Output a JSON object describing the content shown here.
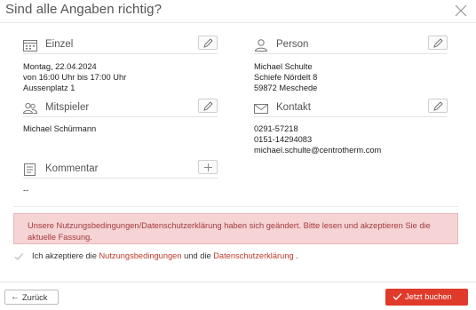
{
  "dialog": {
    "title": "Sind alle Angaben richtig?",
    "close_icon": "close-icon"
  },
  "sections": {
    "einzel": {
      "label": "Einzel",
      "icon": "calendar-icon",
      "lines": [
        "Montag, 22.04.2024",
        "von 16:00 Uhr bis 17:00 Uhr",
        "Aussenplatz 1"
      ]
    },
    "person": {
      "label": "Person",
      "icon": "user-icon",
      "lines": [
        "Michael Schulte",
        "Schiefe Nördelt 8",
        "59872 Meschede"
      ]
    },
    "mitspieler": {
      "label": "Mitspieler",
      "icon": "users-icon",
      "lines": [
        "Michael Schürmann"
      ]
    },
    "kontakt": {
      "label": "Kontakt",
      "icon": "envelope-icon",
      "lines": [
        "0291-57218",
        "0151-14294083",
        "michael.schulte@centrotherm.com"
      ]
    },
    "kommentar": {
      "label": "Kommentar",
      "icon": "comment-icon",
      "value": "--"
    }
  },
  "notice": {
    "text": "Unsere Nutzungsbedingungen/Datenschutzerklärung haben sich geändert. Bitte lesen und akzeptieren Sie die aktuelle Fassung."
  },
  "accept": {
    "prefix": "Ich akzeptiere die",
    "link1": "Nutzungsbedingungen",
    "middle": "und die",
    "link2": "Datenschutzerklärung",
    "suffix": ".",
    "checked": true
  },
  "footer": {
    "back_label": "Zurück",
    "book_label": "Jetzt buchen"
  },
  "colors": {
    "accent": "#e03a2a",
    "notice_bg": "#f6d4d5",
    "notice_text": "#a33a3e",
    "link": "#c0392b"
  }
}
